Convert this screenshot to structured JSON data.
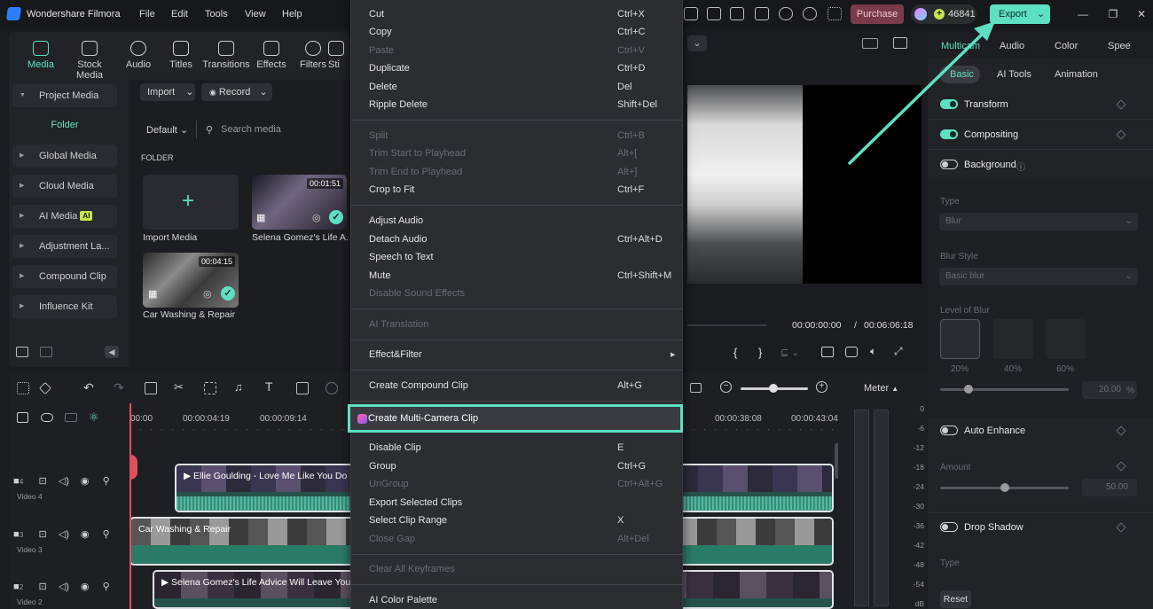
{
  "titlebar": {
    "app_title": "Wondershare Filmora",
    "menus": [
      "File",
      "Edit",
      "Tools",
      "View",
      "Help"
    ],
    "purchase_label": "Purchase",
    "credits": "46841",
    "export_label": "Export"
  },
  "media_tabs": [
    "Media",
    "Stock Media",
    "Audio",
    "Titles",
    "Transitions",
    "Effects",
    "Filters",
    "Sti"
  ],
  "sidebar": {
    "items": [
      {
        "label": "Project Media"
      },
      {
        "label": "Folder"
      },
      {
        "label": "Global Media"
      },
      {
        "label": "Cloud Media"
      },
      {
        "label": "AI Media",
        "badge": "AI"
      },
      {
        "label": "Adjustment La..."
      },
      {
        "label": "Compound Clip"
      },
      {
        "label": "Influence Kit"
      }
    ]
  },
  "media": {
    "import_label": "Import",
    "record_label": "Record",
    "sort_label": "Default",
    "search_placeholder": "Search media",
    "folder_heading": "FOLDER",
    "items": [
      {
        "label": "Import Media"
      },
      {
        "label": "Selena Gomez's Life A...",
        "duration": "00:01:51"
      },
      {
        "label": "Car Washing & Repair",
        "duration": "00:04:15"
      }
    ]
  },
  "context_menu": {
    "groups": [
      [
        {
          "label": "Cut",
          "shortcut": "Ctrl+X",
          "enabled": true
        },
        {
          "label": "Copy",
          "shortcut": "Ctrl+C",
          "enabled": true
        },
        {
          "label": "Paste",
          "shortcut": "Ctrl+V",
          "enabled": false
        },
        {
          "label": "Duplicate",
          "shortcut": "Ctrl+D",
          "enabled": true
        },
        {
          "label": "Delete",
          "shortcut": "Del",
          "enabled": true
        },
        {
          "label": "Ripple Delete",
          "shortcut": "Shift+Del",
          "enabled": true
        }
      ],
      [
        {
          "label": "Split",
          "shortcut": "Ctrl+B",
          "enabled": false
        },
        {
          "label": "Trim Start to Playhead",
          "shortcut": "Alt+[",
          "enabled": false
        },
        {
          "label": "Trim End to Playhead",
          "shortcut": "Alt+]",
          "enabled": false
        },
        {
          "label": "Crop to Fit",
          "shortcut": "Ctrl+F",
          "enabled": true
        }
      ],
      [
        {
          "label": "Adjust Audio",
          "shortcut": "",
          "enabled": true
        },
        {
          "label": "Detach Audio",
          "shortcut": "Ctrl+Alt+D",
          "enabled": true
        },
        {
          "label": "Speech to Text",
          "shortcut": "",
          "enabled": true
        },
        {
          "label": "Mute",
          "shortcut": "Ctrl+Shift+M",
          "enabled": true
        },
        {
          "label": "Disable Sound Effects",
          "shortcut": "",
          "enabled": false
        }
      ],
      [
        {
          "label": "AI Translation",
          "shortcut": "",
          "enabled": false
        }
      ],
      [
        {
          "label": "Effect&Filter",
          "shortcut": "",
          "enabled": true,
          "submenu": true
        }
      ],
      [
        {
          "label": "Create Compound Clip",
          "shortcut": "Alt+G",
          "enabled": true
        }
      ],
      [
        {
          "label": "Create Multi-Camera Clip",
          "shortcut": "",
          "enabled": true,
          "highlighted": true
        }
      ],
      [
        {
          "label": "Disable Clip",
          "shortcut": "E",
          "enabled": true
        },
        {
          "label": "Group",
          "shortcut": "Ctrl+G",
          "enabled": true
        },
        {
          "label": "UnGroup",
          "shortcut": "Ctrl+Alt+G",
          "enabled": false
        },
        {
          "label": "Export Selected Clips",
          "shortcut": "",
          "enabled": true
        },
        {
          "label": "Select Clip Range",
          "shortcut": "X",
          "enabled": true
        },
        {
          "label": "Close Gap",
          "shortcut": "Alt+Del",
          "enabled": false
        }
      ],
      [
        {
          "label": "Clear All Keyframes",
          "shortcut": "",
          "enabled": false
        }
      ],
      [
        {
          "label": "AI Color Palette",
          "shortcut": "",
          "enabled": true
        }
      ]
    ]
  },
  "preview": {
    "current_time": "00:00:00:00",
    "separator": "/",
    "total_time": "00:06:06:18"
  },
  "timeline": {
    "ruler": [
      "00:00",
      "00:00:04:19",
      "00:00:09:14",
      "00:00:38:08",
      "00:00:43:04"
    ],
    "tracks": [
      {
        "num": "4",
        "label": "Video 4",
        "clip": "Ellie Goulding - Love Me Like You Do (V"
      },
      {
        "num": "3",
        "label": "Video 3",
        "clip": "Car Washing & Repair"
      },
      {
        "num": "2",
        "label": "Video 2",
        "clip": "Selena Gomez's Life Advice Will Leave You S"
      }
    ]
  },
  "meter": {
    "label": "Meter",
    "ticks": [
      "0",
      "-6",
      "-12",
      "-18",
      "-24",
      "-30",
      "-36",
      "-42",
      "-48",
      "-54",
      "dB"
    ]
  },
  "right_panel": {
    "tabs": [
      "Multicam",
      "Audio",
      "Color",
      "Spee"
    ],
    "subtabs": [
      "Basic",
      "AI Tools",
      "Animation"
    ],
    "transform": "Transform",
    "compositing": "Compositing",
    "background": "Background",
    "type_label": "Type",
    "type_value": "Blur",
    "blur_style_label": "Blur Style",
    "blur_style_value": "Basic blur",
    "level_label": "Level of Blur",
    "levels": [
      "20%",
      "40%",
      "60%"
    ],
    "level_value": "20.00",
    "level_unit": "%",
    "auto_enhance": "Auto Enhance",
    "amount_label": "Amount",
    "amount_value": "50.00",
    "drop_shadow": "Drop Shadow",
    "type2_label": "Type",
    "reset_label": "Reset"
  },
  "colors": {
    "accent": "#5de0c2",
    "highlight_border": "#5de0c2",
    "purchase_bg": "#7b3a4b"
  }
}
